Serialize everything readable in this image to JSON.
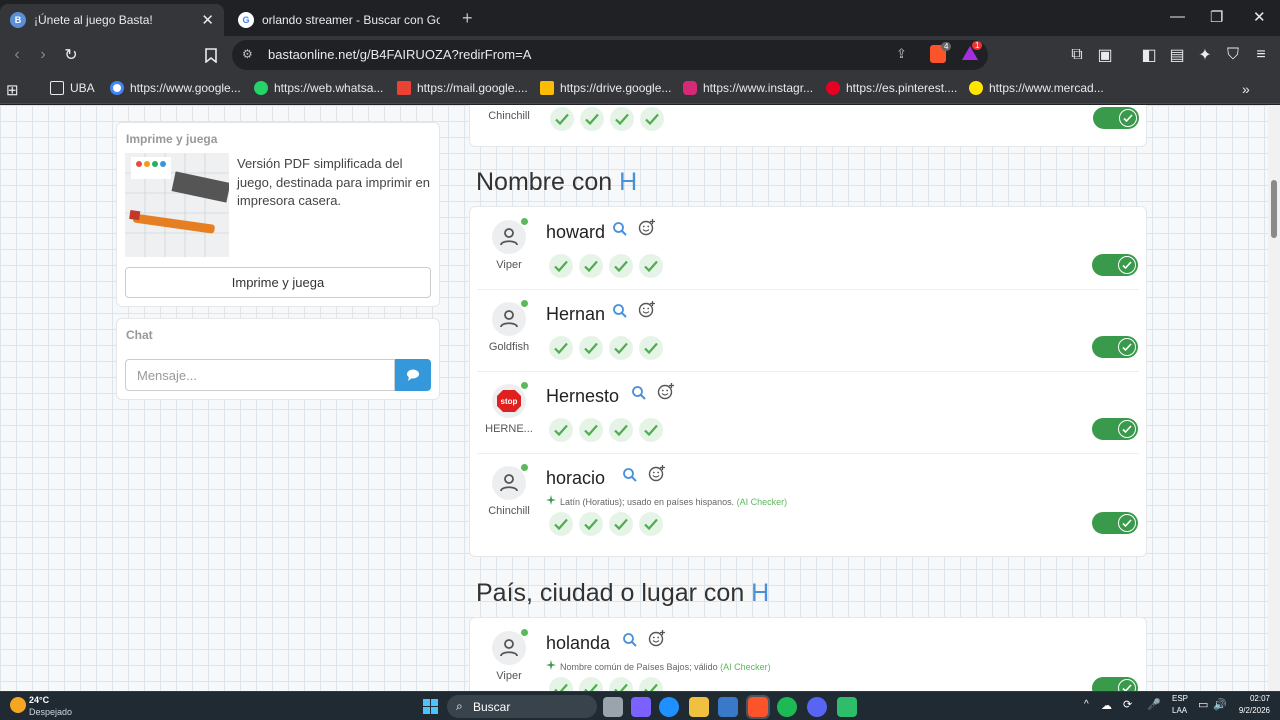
{
  "browser": {
    "tabs": [
      {
        "title": "¡Únete al juego Basta!",
        "active": true
      },
      {
        "title": "orlando streamer - Buscar con Google",
        "active": false
      }
    ],
    "url": "bastaonline.net/g/B4FAIRUOZA?redirFrom=A",
    "shield_count": "4",
    "alert_count": "1",
    "bookmarks": [
      {
        "label": "UBA",
        "icon": "folder-icon"
      },
      {
        "label": "https://www.google...",
        "icon": "google-icon"
      },
      {
        "label": "https://web.whatsa...",
        "icon": "whatsapp-icon"
      },
      {
        "label": "https://mail.google....",
        "icon": "gmail-icon"
      },
      {
        "label": "https://drive.google...",
        "icon": "drive-icon"
      },
      {
        "label": "https://www.instagr...",
        "icon": "instagram-icon"
      },
      {
        "label": "https://es.pinterest....",
        "icon": "pinterest-icon"
      },
      {
        "label": "https://www.mercad...",
        "icon": "mercadolibre-icon"
      }
    ]
  },
  "sidebar": {
    "print_card": {
      "title": "Imprime y juega",
      "description": "Versión PDF simplificada del juego, destinada para imprimir en impresora casera.",
      "button": "Imprime y juega"
    },
    "chat": {
      "title": "Chat",
      "placeholder": "Mensaje..."
    }
  },
  "main": {
    "top_partial": {
      "player": "Chinchill",
      "checks": 4
    },
    "sections": [
      {
        "title": "Nombre con ",
        "letter": "H",
        "answers": [
          {
            "word": "howard",
            "player": "Viper",
            "avatar": "user-icon",
            "checks": 4,
            "note": null
          },
          {
            "word": "Hernan",
            "player": "Goldfish",
            "avatar": "user-icon",
            "checks": 4,
            "note": null
          },
          {
            "word": "Hernesto",
            "player": "HERNE...",
            "avatar": "stop-sign-icon",
            "checks": 4,
            "note": null
          },
          {
            "word": "horacio",
            "player": "Chinchill",
            "avatar": "user-icon",
            "checks": 4,
            "note": "Latín (Horatius); usado en países hispanos.",
            "note_tag": "(AI Checker)"
          }
        ]
      },
      {
        "title": "País, ciudad o lugar con ",
        "letter": "H",
        "answers": [
          {
            "word": "holanda",
            "player": "Viper",
            "avatar": "user-icon",
            "checks": 4,
            "note": "Nombre común de Países Bajos; válido",
            "note_tag": "(AI Checker)"
          }
        ]
      }
    ]
  },
  "taskbar": {
    "weather_temp": "24°C",
    "weather_desc": "Despejado",
    "search": "Buscar",
    "lang": "ESP",
    "lang2": "LAA",
    "time": "02:07",
    "date": "9/2/2026"
  },
  "colors": {
    "accent": "#4a90d9",
    "toggle": "#3a9a4c",
    "check": "#5cb85c",
    "send": "#3498db"
  }
}
